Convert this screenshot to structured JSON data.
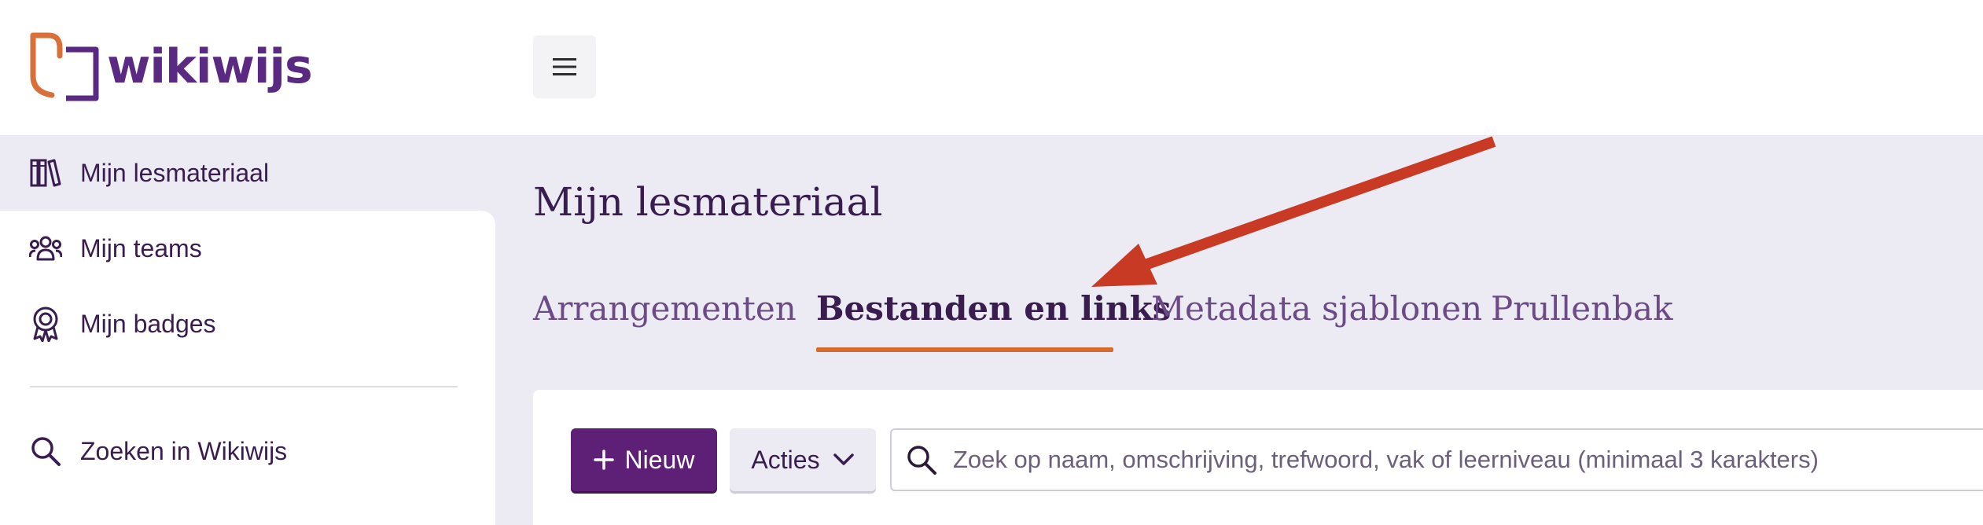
{
  "header": {
    "logo_text": "wikiwijs",
    "menu_icon": "hamburger-icon"
  },
  "sidebar": {
    "items": [
      {
        "label": "Mijn lesmateriaal",
        "icon": "books-icon",
        "active": true
      },
      {
        "label": "Mijn teams",
        "icon": "team-icon"
      },
      {
        "label": "Mijn badges",
        "icon": "badge-icon"
      },
      {
        "label": "Zoeken in Wikiwijs",
        "icon": "search-icon"
      }
    ]
  },
  "main": {
    "title": "Mijn lesmateriaal",
    "tabs": [
      {
        "label": "Arrangementen"
      },
      {
        "label": "Bestanden en links",
        "active": true
      },
      {
        "label": "Metadata sjablonen"
      },
      {
        "label": "Prullenbak"
      }
    ]
  },
  "toolbar": {
    "new_label": "Nieuw",
    "actions_label": "Acties",
    "search_placeholder": "Zoek op naam, omschrijving, trefwoord, vak of leerniveau (minimaal 3 karakters)"
  },
  "colors": {
    "brand_purple": "#5a2a82",
    "logo_orange": "#d9703a",
    "accent_orange": "#d36c2c",
    "button_purple": "#5e2077",
    "background_lavender": "#ecebf3",
    "annotation_arrow": "#c93a24"
  }
}
